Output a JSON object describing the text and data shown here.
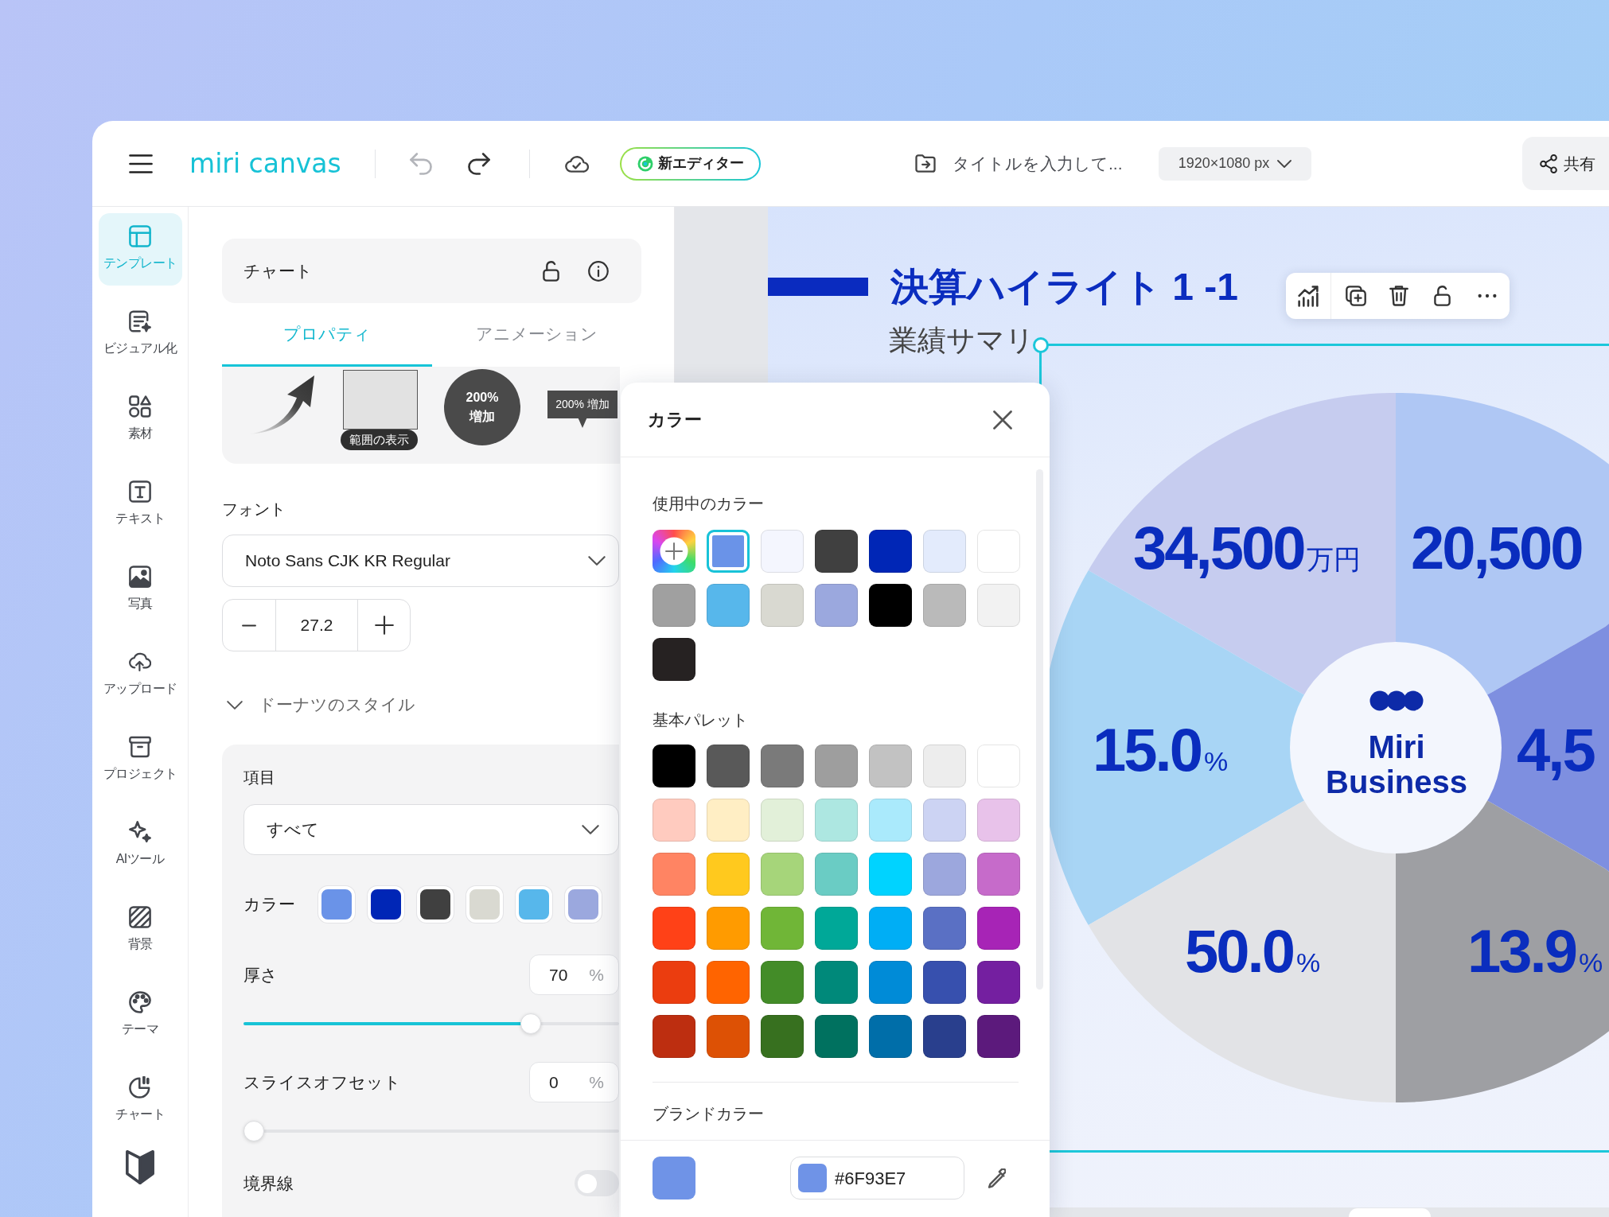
{
  "topbar": {
    "logo": "miri canvas",
    "undo": {
      "disabled": true
    },
    "redo": {
      "disabled": false
    },
    "editor_badge": "新エディター",
    "title_placeholder": "タイトルを入力して...",
    "canvas_size": "1920×1080 px",
    "share_button": "共有"
  },
  "sidebar": {
    "items": [
      {
        "label": "テンプレート",
        "selected": true
      },
      {
        "label": "ビジュアル化",
        "selected": false
      },
      {
        "label": "素材",
        "selected": false
      },
      {
        "label": "テキスト",
        "selected": false
      },
      {
        "label": "写真",
        "selected": false
      },
      {
        "label": "アップロード",
        "selected": false
      },
      {
        "label": "プロジェクト",
        "selected": false
      },
      {
        "label": "AIツール",
        "selected": false
      },
      {
        "label": "背景",
        "selected": false
      },
      {
        "label": "テーマ",
        "selected": false
      },
      {
        "label": "チャート",
        "selected": false
      }
    ]
  },
  "panel": {
    "header": "チャート",
    "tabs": [
      {
        "label": "プロパティ",
        "selected": true
      },
      {
        "label": "アニメーション",
        "selected": false
      }
    ],
    "preview": {
      "range_label": "範囲の表示",
      "circle_label": "200% 増加",
      "tooltip_label": "200% 増加"
    },
    "font_label": "フォント",
    "font": "Noto Sans CJK KR Regular",
    "font_size": "27.2",
    "section": {
      "title": "ドーナツのスタイル",
      "expanded": true
    },
    "item_label": "項目",
    "item_value": "すべて",
    "color_label": "カラー",
    "series_colors": [
      {
        "color": "#6a93e8"
      },
      {
        "color": "#0026b6"
      },
      {
        "color": "#404040"
      },
      {
        "color": "#d9d9d1"
      },
      {
        "color": "#57b7eb"
      },
      {
        "color": "#9ba8de"
      }
    ],
    "thickness": {
      "label": "厚さ",
      "value": "70",
      "unit": "%",
      "level": 0.78
    },
    "slice_offset": {
      "label": "スライスオフセット",
      "value": "0",
      "unit": "%",
      "level": 0
    },
    "border": {
      "label": "境界線",
      "on": false
    }
  },
  "color_popup": {
    "title": "カラー",
    "in_use": {
      "title": "使用中のカラー",
      "colors": [
        {
          "kind": "add",
          "selected": false
        },
        {
          "kind": "swatch",
          "color": "#6a93e8",
          "selected": true
        },
        {
          "kind": "swatch",
          "color": "#f4f6fe",
          "selected": false
        },
        {
          "kind": "swatch",
          "color": "#404040",
          "selected": false
        },
        {
          "kind": "swatch",
          "color": "#0026b6",
          "selected": false
        },
        {
          "kind": "swatch",
          "color": "#e3ebfc",
          "selected": false
        },
        {
          "kind": "swatch",
          "color": "#ffffff",
          "selected": false
        },
        {
          "kind": "swatch",
          "color": "#a0a0a0",
          "selected": false
        },
        {
          "kind": "swatch",
          "color": "#57b7eb",
          "selected": false
        },
        {
          "kind": "swatch",
          "color": "#d9d9d1",
          "selected": false
        },
        {
          "kind": "swatch",
          "color": "#9ba8de",
          "selected": false
        },
        {
          "kind": "swatch",
          "color": "#000000",
          "selected": false
        },
        {
          "kind": "swatch",
          "color": "#bababa",
          "selected": false
        },
        {
          "kind": "swatch",
          "color": "#f2f2f2",
          "selected": false
        },
        {
          "kind": "swatch",
          "color": "#262222",
          "selected": false
        }
      ]
    },
    "palette": {
      "title": "基本パレット",
      "colors": [
        {
          "color": "#000000",
          "selected": false
        },
        {
          "color": "#595959",
          "selected": false
        },
        {
          "color": "#7a7a7a",
          "selected": false
        },
        {
          "color": "#9e9e9e",
          "selected": false
        },
        {
          "color": "#c2c2c2",
          "selected": false
        },
        {
          "color": "#ededed",
          "selected": false
        },
        {
          "color": "#ffffff",
          "selected": false
        },
        {
          "color": "#ffcbbf",
          "selected": false
        },
        {
          "color": "#ffeec4",
          "selected": false
        },
        {
          "color": "#e2f0d9",
          "selected": false
        },
        {
          "color": "#ade7e1",
          "selected": false
        },
        {
          "color": "#aaeafc",
          "selected": false
        },
        {
          "color": "#ccd3f3",
          "selected": false
        },
        {
          "color": "#e8c2ea",
          "selected": false
        },
        {
          "color": "#ff8463",
          "selected": false
        },
        {
          "color": "#ffc91e",
          "selected": false
        },
        {
          "color": "#a6d57a",
          "selected": false
        },
        {
          "color": "#6accc4",
          "selected": false
        },
        {
          "color": "#00d3ff",
          "selected": false
        },
        {
          "color": "#9ca7dd",
          "selected": false
        },
        {
          "color": "#c66bca",
          "selected": false
        },
        {
          "color": "#ff4117",
          "selected": false
        },
        {
          "color": "#ff9b00",
          "selected": false
        },
        {
          "color": "#70b637",
          "selected": false
        },
        {
          "color": "#00a898",
          "selected": false
        },
        {
          "color": "#00aef5",
          "selected": false
        },
        {
          "color": "#5a70c4",
          "selected": false
        },
        {
          "color": "#a724b6",
          "selected": false
        },
        {
          "color": "#eb3d0f",
          "selected": false
        },
        {
          "color": "#ff6400",
          "selected": false
        },
        {
          "color": "#438c28",
          "selected": false
        },
        {
          "color": "#00897a",
          "selected": false
        },
        {
          "color": "#008bd7",
          "selected": false
        },
        {
          "color": "#3750ae",
          "selected": false
        },
        {
          "color": "#741fa0",
          "selected": false
        },
        {
          "color": "#bd2e10",
          "selected": false
        },
        {
          "color": "#dd5105",
          "selected": false
        },
        {
          "color": "#37701f",
          "selected": false
        },
        {
          "color": "#00715f",
          "selected": false
        },
        {
          "color": "#006ea9",
          "selected": false
        },
        {
          "color": "#293f8d",
          "selected": false
        },
        {
          "color": "#5c1a7c",
          "selected": false
        }
      ]
    },
    "brand": {
      "title": "ブランドカラー",
      "color": "#6f93e7",
      "hex": "#6F93E7"
    }
  },
  "slide": {
    "title": "決算ハイライト 1 -1",
    "subtitle": "業績サマリ",
    "donut": {
      "center_label": "Miri Business",
      "slices": [
        {
          "value": "34,500",
          "unit": "万円",
          "color": "#c6ccef"
        },
        {
          "value": "20,500",
          "color": "#afc7f4"
        },
        {
          "value": "15.0",
          "unit": "%",
          "color": "#a8d5f5"
        },
        {
          "value": "4,5",
          "color": "#7e8fe0"
        },
        {
          "value": "50.0",
          "unit": "%",
          "color": "#e2e3e6"
        },
        {
          "value": "13.9",
          "unit": "%",
          "color": "#9e9fa3"
        }
      ]
    }
  }
}
